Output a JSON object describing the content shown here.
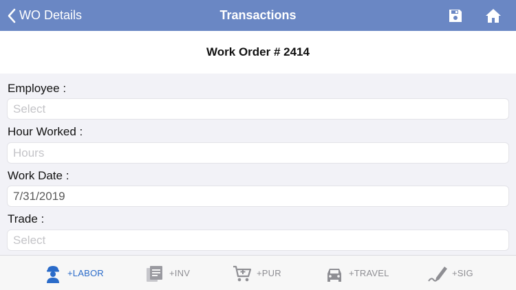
{
  "navbar": {
    "back_label": "WO Details",
    "title": "Transactions",
    "bg_color": "#6a87c4"
  },
  "header": {
    "work_order_title": "Work Order # 2414"
  },
  "form": {
    "employee": {
      "label": "Employee :",
      "placeholder": "Select",
      "value": ""
    },
    "hours": {
      "label": "Hour Worked :",
      "placeholder": "Hours",
      "value": ""
    },
    "work_date": {
      "label": "Work Date :",
      "value": "7/31/2019"
    },
    "trade": {
      "label": "Trade :",
      "placeholder": "Select",
      "value": ""
    }
  },
  "tabbar": {
    "active_color": "#2a6bc9",
    "inactive_color": "#8e8e93",
    "tabs": [
      {
        "label": "+LABOR",
        "icon": "worker-icon",
        "active": true
      },
      {
        "label": "+INV",
        "icon": "clipboard-icon",
        "active": false
      },
      {
        "label": "+PUR",
        "icon": "cart-icon",
        "active": false
      },
      {
        "label": "+TRAVEL",
        "icon": "car-icon",
        "active": false
      },
      {
        "label": "+SIG",
        "icon": "signature-icon",
        "active": false
      }
    ]
  }
}
